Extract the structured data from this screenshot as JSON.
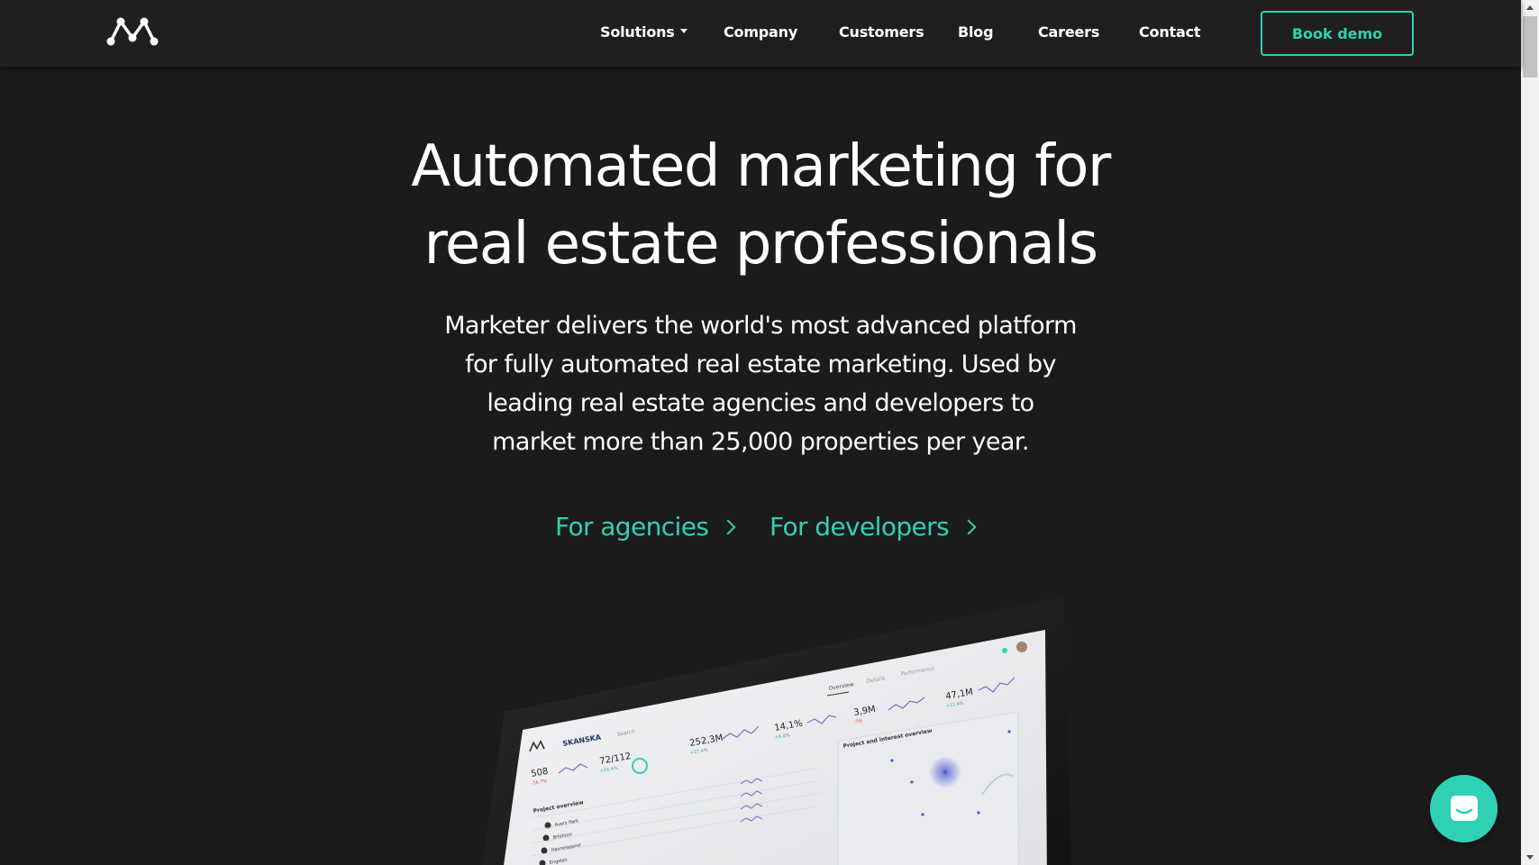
{
  "brand": {
    "logo_icon": "marketer-m-logo-icon",
    "accent": "#2fd1b5"
  },
  "nav": {
    "items": [
      {
        "label": "Solutions",
        "has_dropdown": true
      },
      {
        "label": "Company"
      },
      {
        "label": "Customers"
      },
      {
        "label": "Blog"
      },
      {
        "label": "Careers"
      },
      {
        "label": "Contact"
      }
    ],
    "cta_label": "Book demo"
  },
  "hero": {
    "title_line1": "Automated marketing for",
    "title_line2": "real estate professionals",
    "subtitle_line1": "Marketer delivers the world's most advanced platform",
    "subtitle_line2": "for fully automated real estate marketing. Used by",
    "subtitle_line3": "leading real estate agencies and developers to",
    "subtitle_line4": "market more than 25,000 properties per year.",
    "cta_agencies": "For agencies",
    "cta_developers": "For developers"
  },
  "dashboard": {
    "brand": "SKANSKA",
    "search_placeholder": "Search",
    "tabs": [
      "Overview",
      "Details",
      "Performance"
    ],
    "kpis": [
      {
        "value": "508",
        "delta": "-16.7%"
      },
      {
        "value": "72/112",
        "delta": "+24.4%"
      },
      {
        "value": "252,3M",
        "delta": "+27.4%"
      },
      {
        "value": "14,1%",
        "delta": "+4.4%"
      },
      {
        "value": "3,9M",
        "delta": "-7%"
      },
      {
        "value": "47,1M",
        "delta": "+11.4%"
      }
    ],
    "section_project": "Project overview",
    "section_map": "Project and interest overview",
    "rows": [
      "Avery Park",
      "Brighton",
      "Havnelageret",
      "Engelen"
    ]
  },
  "chat": {
    "icon": "chat-bubble-icon"
  }
}
